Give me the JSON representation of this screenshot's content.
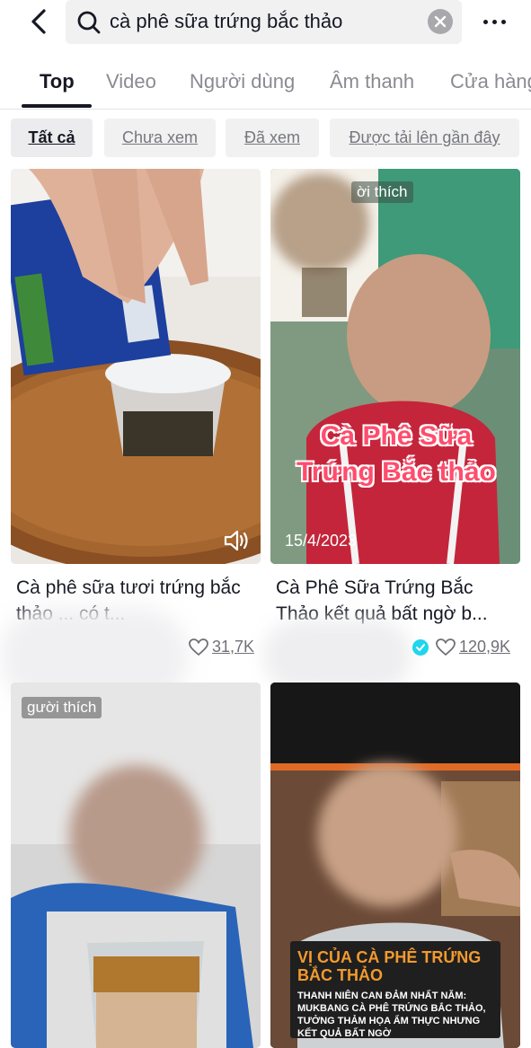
{
  "search": {
    "query": "cà phê sữa trứng bắc thảo"
  },
  "tabs": [
    {
      "label": "Top",
      "active": true
    },
    {
      "label": "Video",
      "active": false
    },
    {
      "label": "Người dùng",
      "active": false
    },
    {
      "label": "Âm thanh",
      "active": false
    },
    {
      "label": "Cửa hàng",
      "active": false
    }
  ],
  "filters": [
    {
      "label": "Tất cả",
      "active": true
    },
    {
      "label": "Chưa xem",
      "active": false
    },
    {
      "label": "Đã xem",
      "active": false
    },
    {
      "label": "Được tải lên gần đây",
      "active": false
    }
  ],
  "results": [
    {
      "title": "Cà phê sữa tươi trứng bắc thảo ... có t...",
      "likes": "31,7K",
      "verified": false
    },
    {
      "title": "Cà Phê Sữa Trứng Bắc Thảo kết quả bất ngờ b...",
      "likes": "120,9K",
      "verified": true,
      "overlay_label": "ời thích",
      "overlay_title": "Cà Phê Sữa Trứng Bắc thảo",
      "date": "15/4/2023"
    },
    {
      "overlay_label": "gười thích"
    },
    {
      "overlay_headline": "VỊ CỦA CÀ PHÊ TRỨNG BẮC THẢO",
      "overlay_caption": "THANH NIÊN CAN ĐẢM NHẤT NĂM: MUKBANG CÀ PHÊ TRỨNG BẮC THẢO, TƯỞNG THẢM HỌA ẨM THỰC NHƯNG KẾT QUẢ BẤT NGỜ"
    }
  ],
  "colors": {
    "text_primary": "#161823",
    "text_secondary": "#8a8b91",
    "chip_bg": "#f1f1f2",
    "verified": "#20d5ec",
    "overlay_title": "#ff3355"
  }
}
